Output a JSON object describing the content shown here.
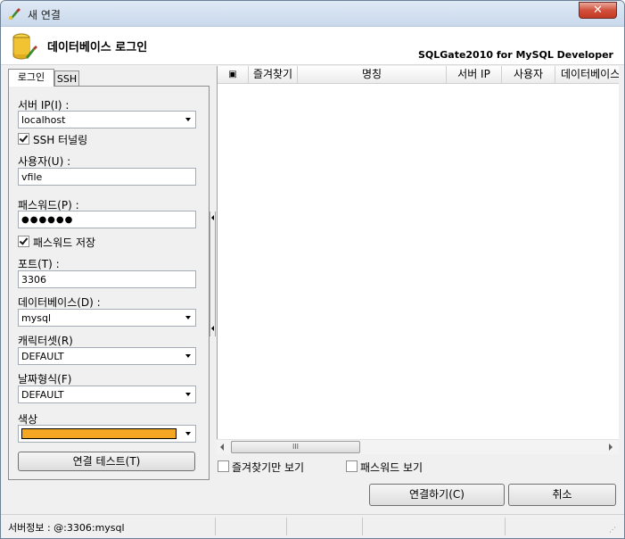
{
  "window": {
    "title": "새 연결",
    "close_label": "✕"
  },
  "header": {
    "title": "데이터베이스 로그인",
    "product": "SQLGate2010 for MySQL Developer"
  },
  "tabs": [
    {
      "label": "로그인"
    },
    {
      "label": "SSH"
    }
  ],
  "login": {
    "server_ip": {
      "label": "서버 IP(I) :",
      "value": "localhost"
    },
    "ssh_tunnel": {
      "label": "SSH 터널링",
      "checked": true
    },
    "user": {
      "label": "사용자(U) :",
      "value": "vfile"
    },
    "password": {
      "label": "패스워드(P) :",
      "value": "●●●●●●"
    },
    "save_password": {
      "label": "패스워드 저장",
      "checked": true
    },
    "port": {
      "label": "포트(T) :",
      "value": "3306"
    },
    "database": {
      "label": "데이터베이스(D) :",
      "value": "mysql"
    },
    "charset": {
      "label": "캐릭터셋(R)",
      "value": "DEFAULT"
    },
    "date_format": {
      "label": "날짜형식(F)",
      "value": "DEFAULT"
    },
    "color": {
      "label": "색상",
      "value": "#f5a623"
    },
    "test_button": "연결 테스트(T)"
  },
  "grid": {
    "columns": [
      "▣",
      "즐겨찾기",
      "명칭",
      "서버 IP",
      "사용자",
      "데이터베이스"
    ],
    "scroll_thumb": "III"
  },
  "options": {
    "favorites_only": "즐겨찾기만 보기",
    "show_password": "패스워드 보기"
  },
  "buttons": {
    "connect": "연결하기(C)",
    "cancel": "취소"
  },
  "status": {
    "text": "서버정보 : @:3306:mysql"
  }
}
